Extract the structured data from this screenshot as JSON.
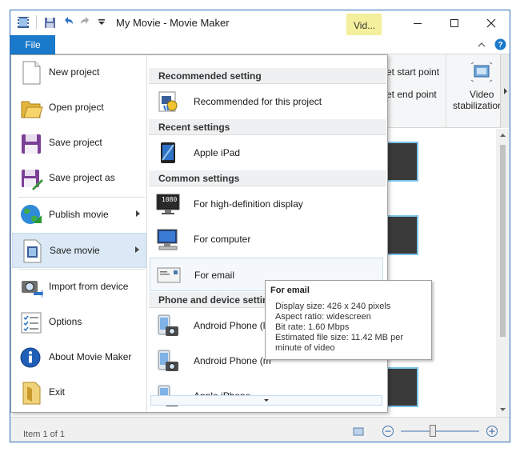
{
  "window": {
    "title": "My Movie - Movie Maker",
    "context_tab": "Vid..."
  },
  "ribbon": {
    "file_tab": "File",
    "set_start_point": "et start point",
    "set_end_point": "et end point",
    "video_stabilization_line1": "Video",
    "video_stabilization_line2": "stabilization"
  },
  "file_menu": {
    "items": [
      {
        "label": "New project",
        "icon": "new-project-icon"
      },
      {
        "label": "Open project",
        "icon": "open-folder-icon"
      },
      {
        "label": "Save project",
        "icon": "save-floppy-icon"
      },
      {
        "label": "Save project as",
        "icon": "save-as-icon"
      },
      {
        "label": "Publish movie",
        "icon": "globe-icon"
      },
      {
        "label": "Save movie",
        "icon": "film-icon"
      },
      {
        "label": "Import from device",
        "icon": "camera-import-icon"
      },
      {
        "label": "Options",
        "icon": "options-list-icon"
      },
      {
        "label": "About Movie Maker",
        "icon": "info-icon"
      },
      {
        "label": "Exit",
        "icon": "exit-door-icon"
      }
    ]
  },
  "save_movie_submenu": {
    "section_recommended": "Recommended setting",
    "recommended_item": "Recommended for this project",
    "section_recent": "Recent settings",
    "recent_item": "Apple iPad",
    "section_common": "Common settings",
    "common_items": [
      "For high-definition display",
      "For computer",
      "For email"
    ],
    "section_phone": "Phone and device settings",
    "phone_items": [
      "Android Phone (la",
      "Android Phone (m",
      "Apple iPhone"
    ],
    "hd_badge": "1080"
  },
  "tooltip": {
    "title": "For email",
    "display_size": "Display size: 426 x 240 pixels",
    "aspect_ratio": "Aspect ratio: widescreen",
    "bit_rate": "Bit rate: 1.60 Mbps",
    "file_size_line1": "Estimated file size: 11.42 MB per",
    "file_size_line2": "minute of video"
  },
  "status": {
    "item_count": "Item 1 of 1"
  },
  "colors": {
    "file_tab": "#1979ca",
    "context_tab": "#f3ef9c",
    "menu_highlight": "#dbe9f6"
  }
}
